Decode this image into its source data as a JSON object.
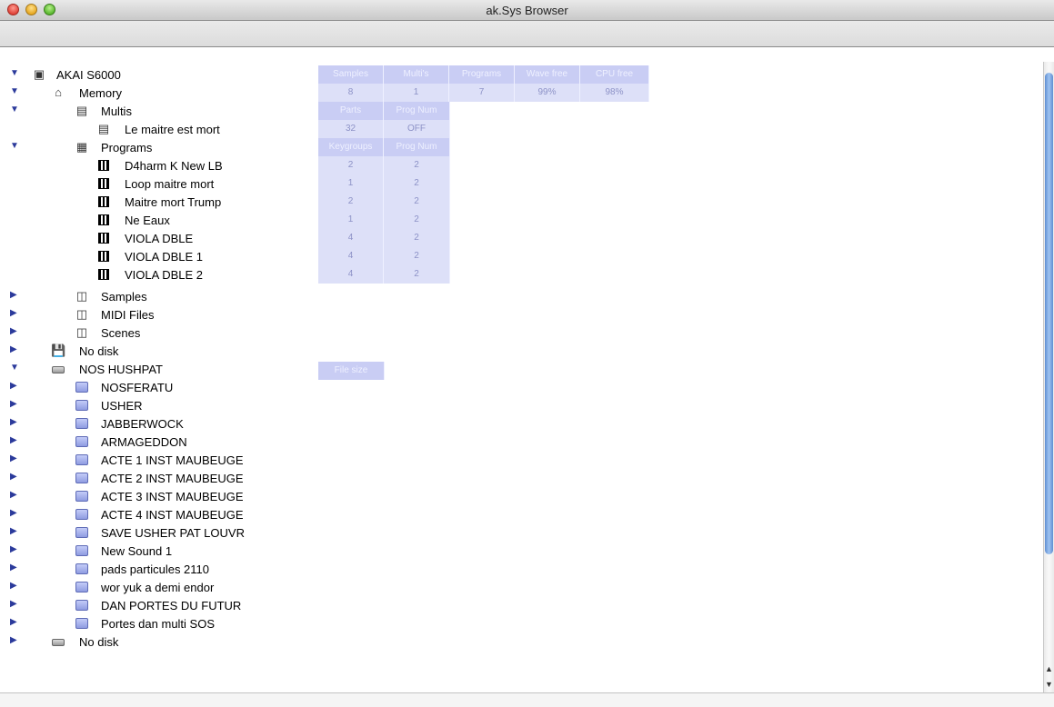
{
  "window": {
    "title": "ak.Sys Browser"
  },
  "tree": {
    "akai": {
      "label": "AKAI S6000"
    },
    "memory": {
      "label": "Memory"
    },
    "multis": {
      "label": "Multis"
    },
    "multi_item": {
      "label": "Le maitre est mort"
    },
    "programs": {
      "label": "Programs"
    },
    "program_items": [
      "D4harm K New LB",
      "Loop maitre mort",
      "Maitre mort Trump",
      "Ne Eaux",
      "VIOLA DBLE",
      "VIOLA DBLE 1",
      "VIOLA DBLE 2"
    ],
    "samples": {
      "label": "Samples"
    },
    "midi_files": {
      "label": "MIDI Files"
    },
    "scenes": {
      "label": "Scenes"
    },
    "no_disk_1": {
      "label": "No disk"
    },
    "nos_hushpat": {
      "label": "NOS HUSHPAT"
    },
    "folders": [
      "NOSFERATU",
      "USHER",
      "JABBERWOCK",
      "ARMAGEDDON",
      "ACTE 1 INST MAUBEUGE",
      "ACTE 2 INST MAUBEUGE",
      "ACTE 3 INST MAUBEUGE",
      "ACTE 4 INST MAUBEUGE",
      "SAVE USHER PAT LOUVR",
      "New Sound   1",
      "pads particules 2110",
      "wor yuk a demi endor",
      "DAN PORTES DU FUTUR",
      "Portes dan multi SOS"
    ],
    "no_disk_2": {
      "label": "No disk"
    }
  },
  "summary": {
    "headers": [
      "Samples",
      "Multi's",
      "Programs",
      "Wave free",
      "CPU free"
    ],
    "values": [
      "8",
      "1",
      "7",
      "99%",
      "98%"
    ]
  },
  "multis_info": {
    "headers": [
      "Parts",
      "Prog Num"
    ],
    "values": [
      "32",
      "OFF"
    ]
  },
  "programs_info": {
    "headers": [
      "Keygroups",
      "Prog Num"
    ],
    "rows": [
      [
        "2",
        "2"
      ],
      [
        "1",
        "2"
      ],
      [
        "2",
        "2"
      ],
      [
        "1",
        "2"
      ],
      [
        "4",
        "2"
      ],
      [
        "4",
        "2"
      ],
      [
        "4",
        "2"
      ]
    ]
  },
  "disk_info": {
    "header": "File size"
  },
  "icons": {
    "expanded": "triangle-down-icon",
    "collapsed": "triangle-right-icon",
    "computer": "computer-icon",
    "memory": "memory-icon",
    "multis": "multis-icon",
    "program": "program-icon",
    "samples": "samples-icon",
    "midi": "midi-files-icon",
    "scenes": "scenes-icon",
    "floppy": "floppy-disk-icon",
    "drive": "drive-icon",
    "folder": "folder-icon"
  },
  "colors": {
    "cell_bg": "#dde0f8",
    "header_bg": "#c9cdf4",
    "text_blue": "#8d92c7",
    "triangle_blue": "#2b3a9b"
  }
}
